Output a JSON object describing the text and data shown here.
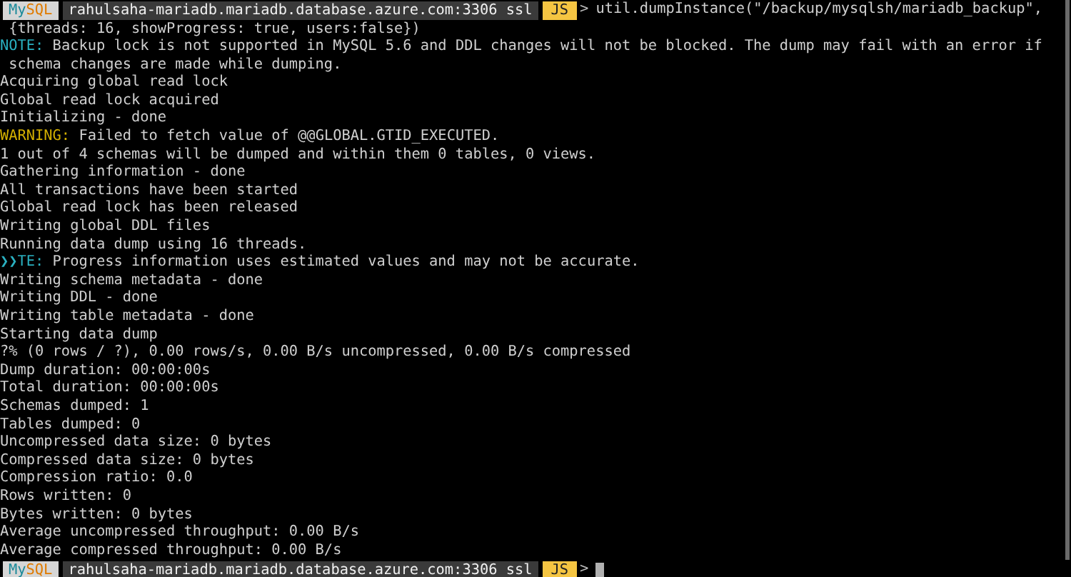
{
  "terminal": {
    "lines": [
      {
        "kind": "prompt",
        "mode_parts": [
          "My",
          "SQL"
        ],
        "host": "rahulsaha-mariadb.mariadb.database.azure.com:3306 ssl",
        "language": "JS",
        "arrow": ">",
        "command": "util.dumpInstance(\"/backup/mysqlsh/mariadb_backup\","
      },
      {
        "kind": "plain",
        "text": " {threads: 16, showProgress: true, users:false})"
      },
      {
        "kind": "note",
        "prefix": "NOTE:",
        "text": " Backup lock is not supported in MySQL 5.6 and DDL changes will not be blocked. The dump may fail with an error if"
      },
      {
        "kind": "plain",
        "text": " schema changes are made while dumping."
      },
      {
        "kind": "plain",
        "text": "Acquiring global read lock"
      },
      {
        "kind": "plain",
        "text": "Global read lock acquired"
      },
      {
        "kind": "plain",
        "text": "Initializing - done"
      },
      {
        "kind": "warning",
        "prefix": "WARNING:",
        "text": " Failed to fetch value of @@GLOBAL.GTID_EXECUTED."
      },
      {
        "kind": "plain",
        "text": "1 out of 4 schemas will be dumped and within them 0 tables, 0 views."
      },
      {
        "kind": "plain",
        "text": "Gathering information - done"
      },
      {
        "kind": "plain",
        "text": "All transactions have been started"
      },
      {
        "kind": "plain",
        "text": "Global read lock has been released"
      },
      {
        "kind": "plain",
        "text": "Writing global DDL files"
      },
      {
        "kind": "plain",
        "text": "Running data dump using 16 threads."
      },
      {
        "kind": "note",
        "prefix": "❯❯TE:",
        "text": " Progress information uses estimated values and may not be accurate."
      },
      {
        "kind": "plain",
        "text": "Writing schema metadata - done"
      },
      {
        "kind": "plain",
        "text": "Writing DDL - done"
      },
      {
        "kind": "plain",
        "text": "Writing table metadata - done"
      },
      {
        "kind": "plain",
        "text": "Starting data dump"
      },
      {
        "kind": "plain",
        "text": "?% (0 rows / ?), 0.00 rows/s, 0.00 B/s uncompressed, 0.00 B/s compressed"
      },
      {
        "kind": "plain",
        "text": "Dump duration: 00:00:00s"
      },
      {
        "kind": "plain",
        "text": "Total duration: 00:00:00s"
      },
      {
        "kind": "plain",
        "text": "Schemas dumped: 1"
      },
      {
        "kind": "plain",
        "text": "Tables dumped: 0"
      },
      {
        "kind": "plain",
        "text": "Uncompressed data size: 0 bytes"
      },
      {
        "kind": "plain",
        "text": "Compressed data size: 0 bytes"
      },
      {
        "kind": "plain",
        "text": "Compression ratio: 0.0"
      },
      {
        "kind": "plain",
        "text": "Rows written: 0"
      },
      {
        "kind": "plain",
        "text": "Bytes written: 0 bytes"
      },
      {
        "kind": "plain",
        "text": "Average uncompressed throughput: 0.00 B/s"
      },
      {
        "kind": "plain",
        "text": "Average compressed throughput: 0.00 B/s"
      },
      {
        "kind": "prompt",
        "mode_parts": [
          "My",
          "SQL"
        ],
        "host": "rahulsaha-mariadb.mariadb.database.azure.com:3306 ssl",
        "language": "JS",
        "arrow": ">",
        "cursor": true
      }
    ]
  }
}
